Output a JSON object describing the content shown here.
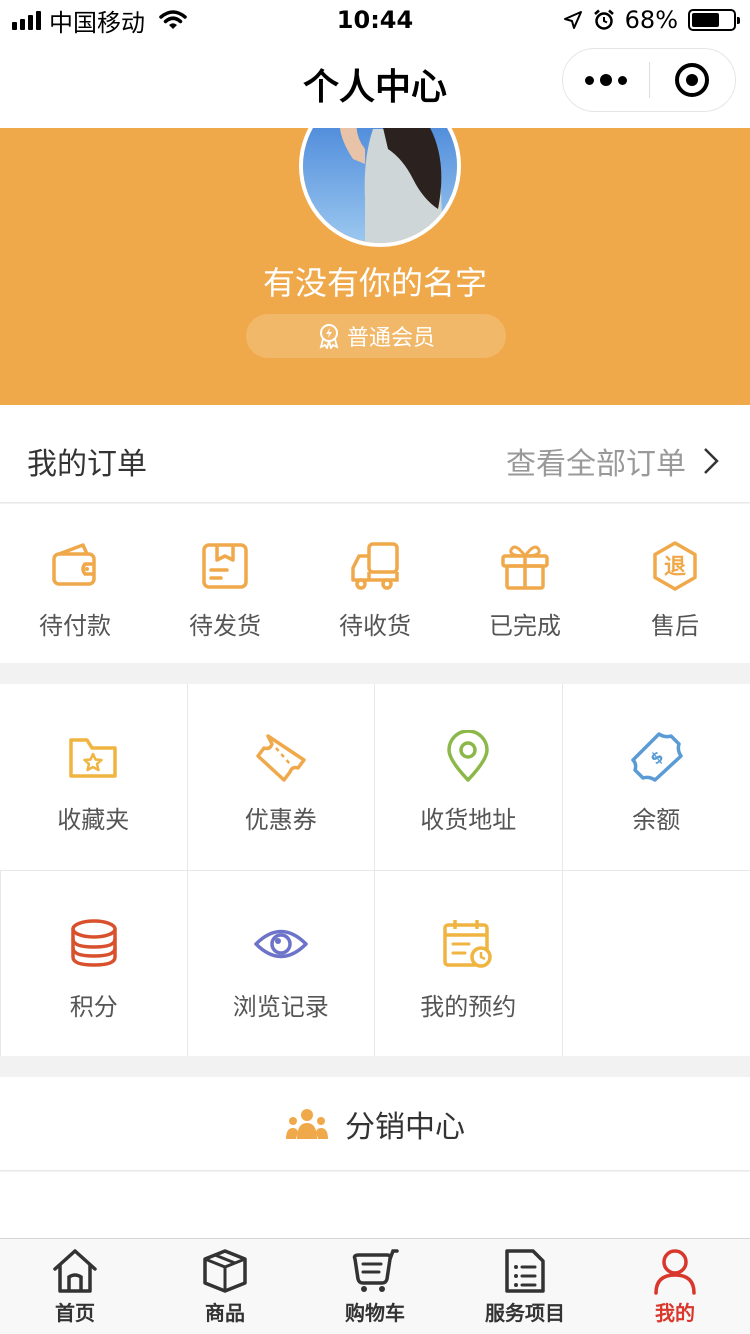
{
  "status_bar": {
    "carrier": "中国移动",
    "time": "10:44",
    "battery": "68%",
    "battery_level": 0.68
  },
  "nav": {
    "title": "个人中心"
  },
  "profile": {
    "username": "有没有你的名字",
    "member_level": "普通会员",
    "header_color": "#f0a94a"
  },
  "orders": {
    "title": "我的订单",
    "view_all": "查看全部订单",
    "items": [
      {
        "label": "待付款",
        "icon": "wallet-icon"
      },
      {
        "label": "待发货",
        "icon": "package-icon"
      },
      {
        "label": "待收货",
        "icon": "delivery-truck-icon"
      },
      {
        "label": "已完成",
        "icon": "gift-icon"
      },
      {
        "label": "售后",
        "icon": "refund-icon",
        "glyph": "退"
      }
    ]
  },
  "tools": [
    {
      "label": "收藏夹",
      "icon": "favorites-folder-icon",
      "color": "#f0b440"
    },
    {
      "label": "优惠券",
      "icon": "coupon-icon",
      "color": "#f0a94a"
    },
    {
      "label": "收货地址",
      "icon": "location-pin-icon",
      "color": "#8cb84a"
    },
    {
      "label": "余额",
      "icon": "balance-money-icon",
      "color": "#5b9bd5"
    },
    {
      "label": "积分",
      "icon": "points-coins-icon",
      "color": "#d9502c"
    },
    {
      "label": "浏览记录",
      "icon": "eye-icon",
      "color": "#6c73c8"
    },
    {
      "label": "我的预约",
      "icon": "calendar-icon",
      "color": "#f0b440"
    }
  ],
  "distribution": {
    "label": "分销中心",
    "icon": "team-icon"
  },
  "tab_bar": {
    "items": [
      {
        "label": "首页",
        "icon": "home-icon"
      },
      {
        "label": "商品",
        "icon": "box-icon"
      },
      {
        "label": "购物车",
        "icon": "cart-icon"
      },
      {
        "label": "服务项目",
        "icon": "list-document-icon"
      },
      {
        "label": "我的",
        "icon": "user-icon",
        "active": true
      }
    ],
    "active_color": "#d9362c"
  },
  "accent_color": "#f0a94a"
}
